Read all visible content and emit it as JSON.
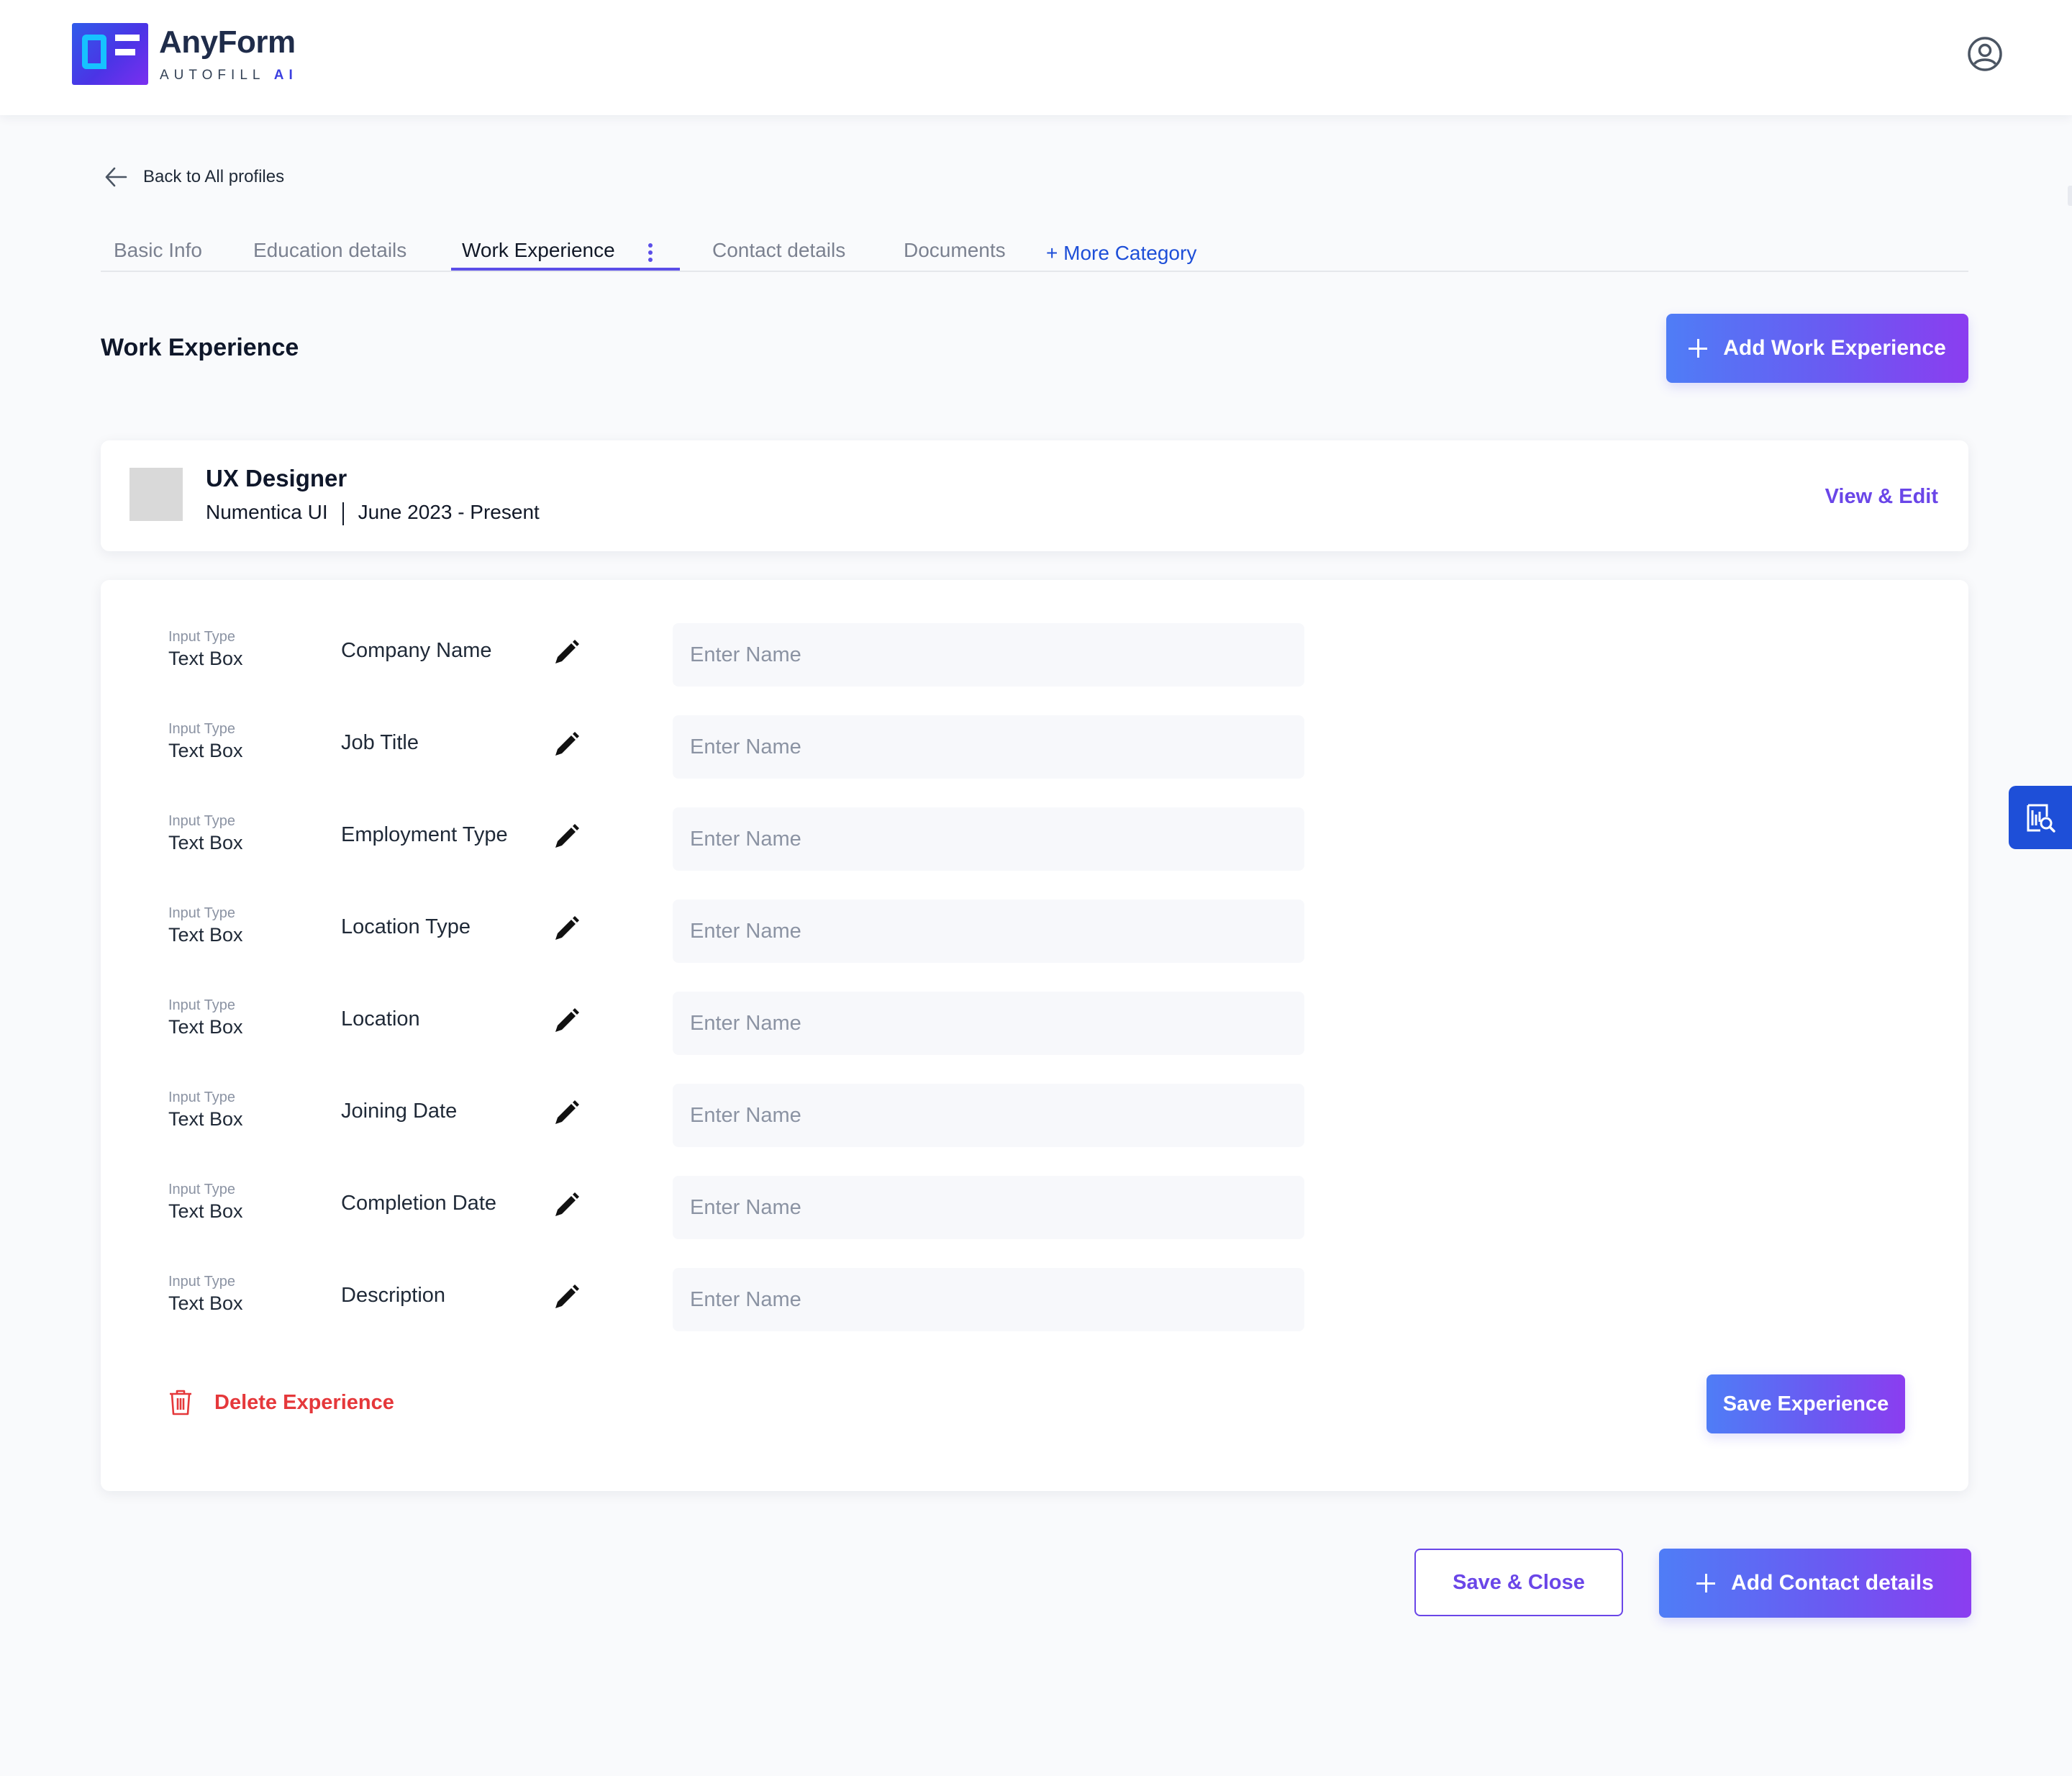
{
  "brand": {
    "name": "AnyForm",
    "tagline": "AUTOFILL",
    "tagline_ai": "AI"
  },
  "header": {
    "profile_icon": "user-circle-icon"
  },
  "nav": {
    "back_label": "Back to All profiles"
  },
  "tabs": [
    {
      "label": "Basic Info",
      "active": false
    },
    {
      "label": "Education details",
      "active": false
    },
    {
      "label": "Work Experience",
      "active": true
    },
    {
      "label": "Contact details",
      "active": false
    },
    {
      "label": "Documents",
      "active": false
    },
    {
      "label": "+ More Category",
      "active": false
    }
  ],
  "section": {
    "title": "Work Experience",
    "add_button": "Add Work Experience"
  },
  "experience": {
    "title": "UX Designer",
    "company": "Numentica UI",
    "period": "June 2023 - Present",
    "view_edit": "View & Edit"
  },
  "form": {
    "fields": [
      {
        "input_type_label": "Input Type",
        "input_type": "Text Box",
        "name": "Company Name",
        "value": "",
        "placeholder": "Enter Name"
      },
      {
        "input_type_label": "Input Type",
        "input_type": "Text Box",
        "name": "Job Title",
        "value": "",
        "placeholder": "Enter Name"
      },
      {
        "input_type_label": "Input Type",
        "input_type": "Text Box",
        "name": "Employment Type",
        "value": "",
        "placeholder": "Enter Name"
      },
      {
        "input_type_label": "Input Type",
        "input_type": "Text Box",
        "name": "Location Type",
        "value": "",
        "placeholder": "Enter Name"
      },
      {
        "input_type_label": "Input Type",
        "input_type": "Text Box",
        "name": "Location",
        "value": "",
        "placeholder": "Enter Name"
      },
      {
        "input_type_label": "Input Type",
        "input_type": "Text Box",
        "name": "Joining Date",
        "value": "",
        "placeholder": "Enter Name"
      },
      {
        "input_type_label": "Input Type",
        "input_type": "Text Box",
        "name": "Completion Date",
        "value": "",
        "placeholder": "Enter Name"
      },
      {
        "input_type_label": "Input Type",
        "input_type": "Text Box",
        "name": "Description",
        "value": "",
        "placeholder": "Enter Name"
      }
    ],
    "delete_label": "Delete Experience",
    "save_label": "Save Experience"
  },
  "footer": {
    "save_close": "Save & Close",
    "add_contact": "Add Contact details"
  },
  "colors": {
    "accent": "#6a46e8",
    "primary_blue": "#1e4fd8",
    "danger": "#e5383b"
  },
  "icons": {
    "back": "arrow-left-icon",
    "edit": "pencil-icon",
    "delete": "trash-icon",
    "plus": "plus-icon",
    "side_tool": "report-search-icon"
  }
}
